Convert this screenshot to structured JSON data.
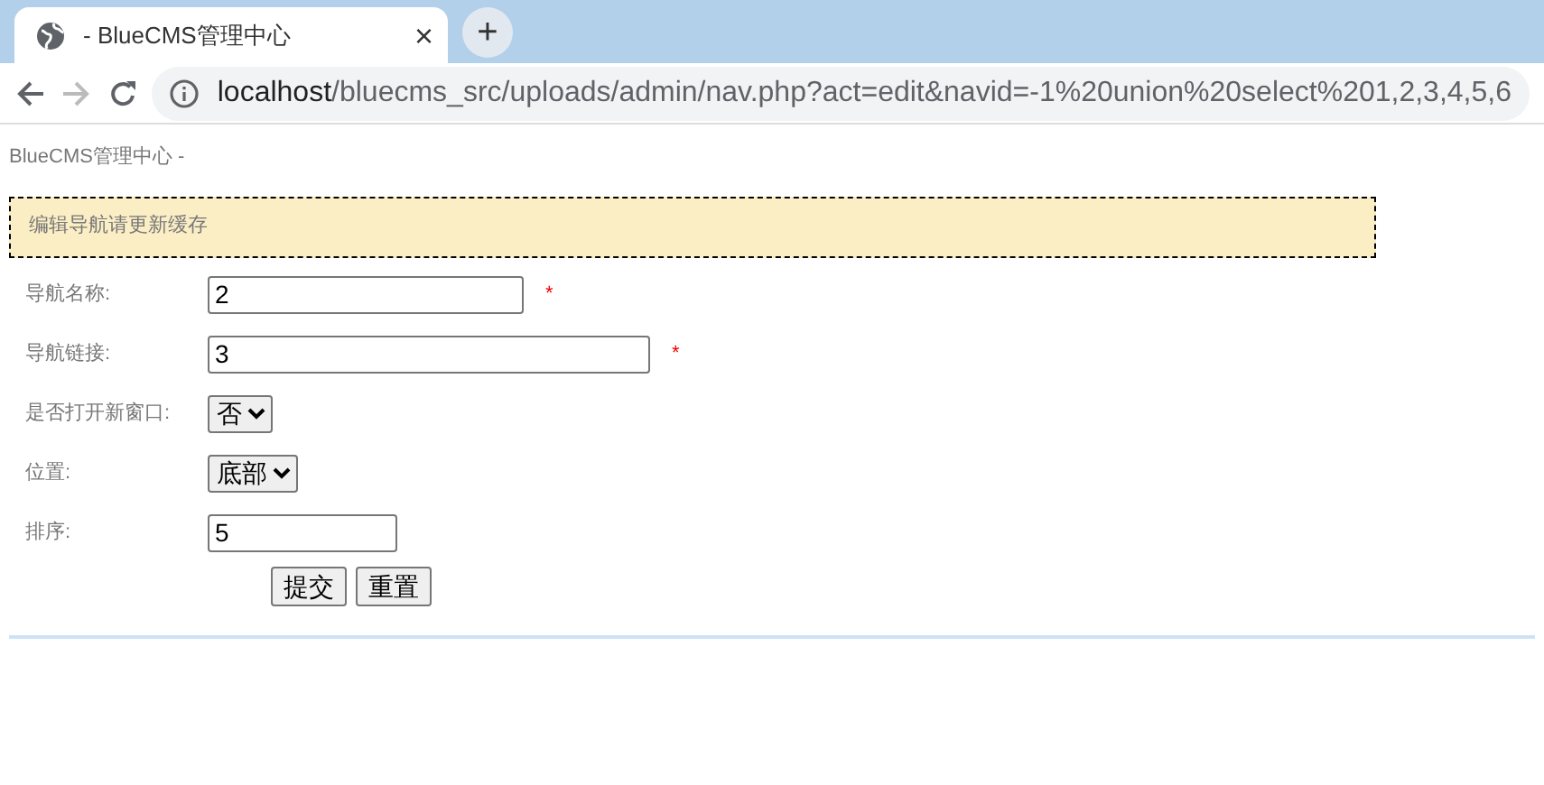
{
  "browser": {
    "tab_title": "- BlueCMS管理中心",
    "close": "×",
    "new_tab": "+",
    "url_host": "localhost",
    "url_path": "/bluecms_src/uploads/admin/nav.php?act=edit&navid=-1%20union%20select%201,2,3,4,5,6"
  },
  "page": {
    "heading": "BlueCMS管理中心 - ",
    "notice": "编辑导航请更新缓存",
    "fields": [
      {
        "kind": "text",
        "label": "导航名称:",
        "value": "2",
        "mark": "*"
      },
      {
        "kind": "text",
        "label": "导航链接:",
        "value": "3",
        "mark": "*"
      },
      {
        "kind": "select",
        "label": "是否打开新窗口:",
        "value": "否"
      },
      {
        "kind": "select",
        "label": "位置:",
        "value": "底部"
      },
      {
        "kind": "text",
        "label": "排序:",
        "value": "5"
      }
    ],
    "buttons": [
      "提交",
      "重置"
    ]
  }
}
